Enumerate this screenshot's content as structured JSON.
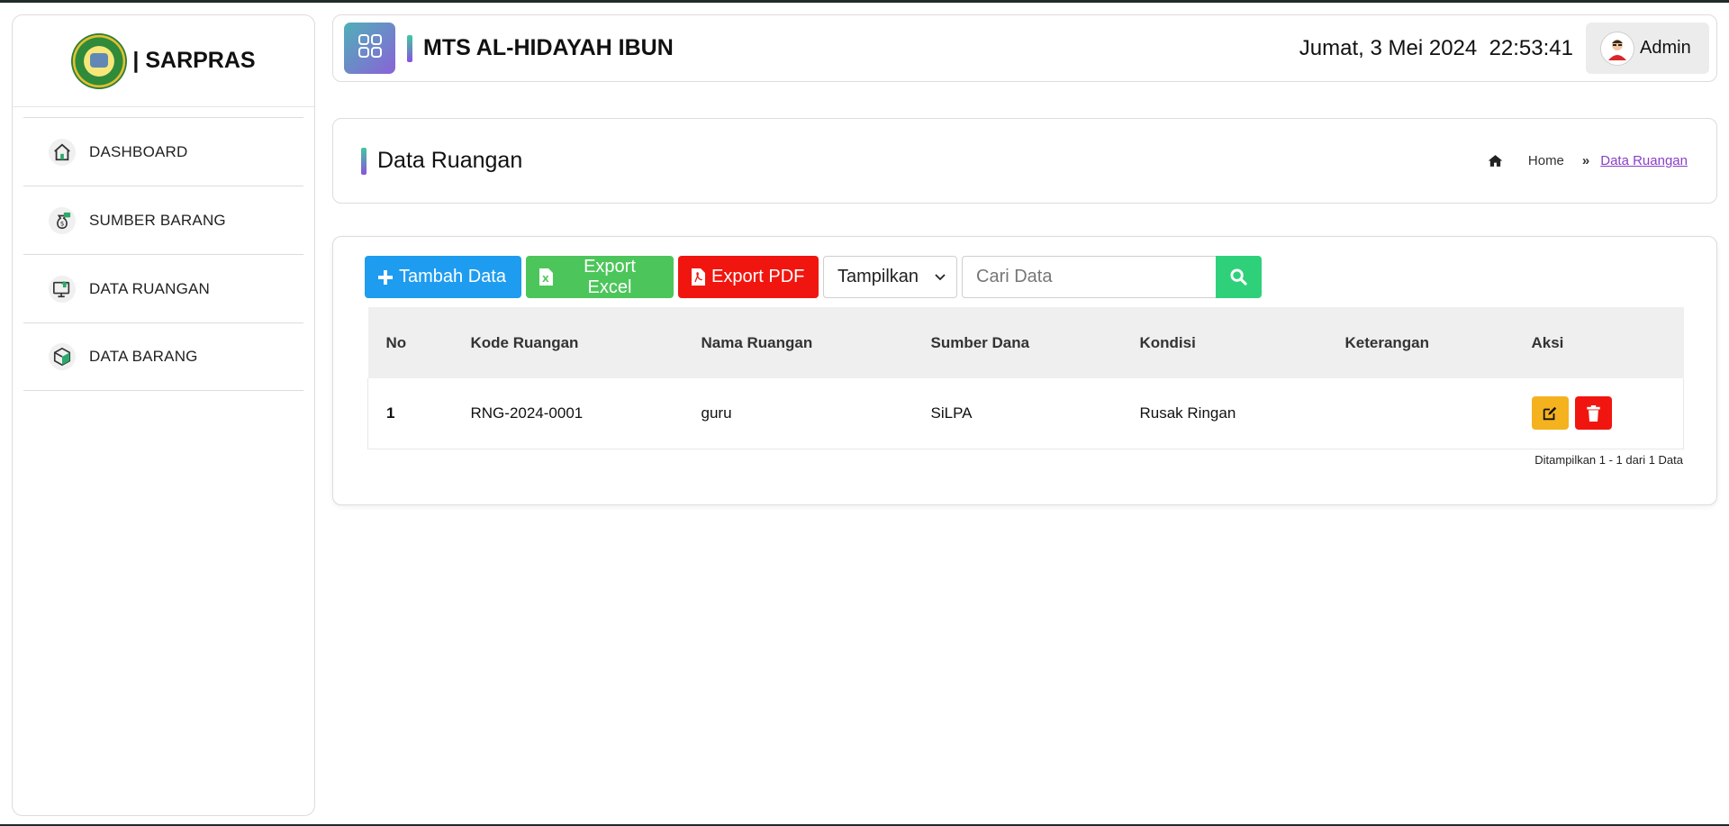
{
  "sidebar": {
    "brand_text": "| SARPRAS",
    "items": [
      {
        "label": "DASHBOARD",
        "icon": "home-icon"
      },
      {
        "label": "SUMBER BARANG",
        "icon": "money-bag-icon"
      },
      {
        "label": "DATA RUANGAN",
        "icon": "monitor-home-icon"
      },
      {
        "label": "DATA BARANG",
        "icon": "box-icon"
      }
    ]
  },
  "header": {
    "school_name": "MTS AL-HIDAYAH IBUN",
    "datetime": "Jumat, 3 Mei 2024  22:53:41",
    "user_name": "Admin"
  },
  "page": {
    "title": "Data Ruangan",
    "breadcrumb": {
      "home": "Home",
      "current": "Data Ruangan"
    }
  },
  "toolbar": {
    "add_label": "Tambah Data",
    "excel_label": "Export Excel",
    "pdf_label": "Export PDF",
    "display_select": "Tampilkan",
    "search_placeholder": "Cari Data"
  },
  "table": {
    "headers": [
      "No",
      "Kode Ruangan",
      "Nama Ruangan",
      "Sumber Dana",
      "Kondisi",
      "Keterangan",
      "Aksi"
    ],
    "rows": [
      {
        "no": "1",
        "kode": "RNG-2024-0001",
        "nama": "guru",
        "sumber": "SiLPA",
        "kondisi": "Rusak Ringan",
        "keterangan": ""
      }
    ],
    "footer": "Ditampilkan 1 - 1 dari 1 Data"
  },
  "colors": {
    "primary": "#1e9cf0",
    "excel": "#4cc65a",
    "pdf": "#f0160f",
    "search": "#2ed17a",
    "edit": "#f5b21f",
    "delete": "#f0160f",
    "link": "#8a3fc7"
  }
}
